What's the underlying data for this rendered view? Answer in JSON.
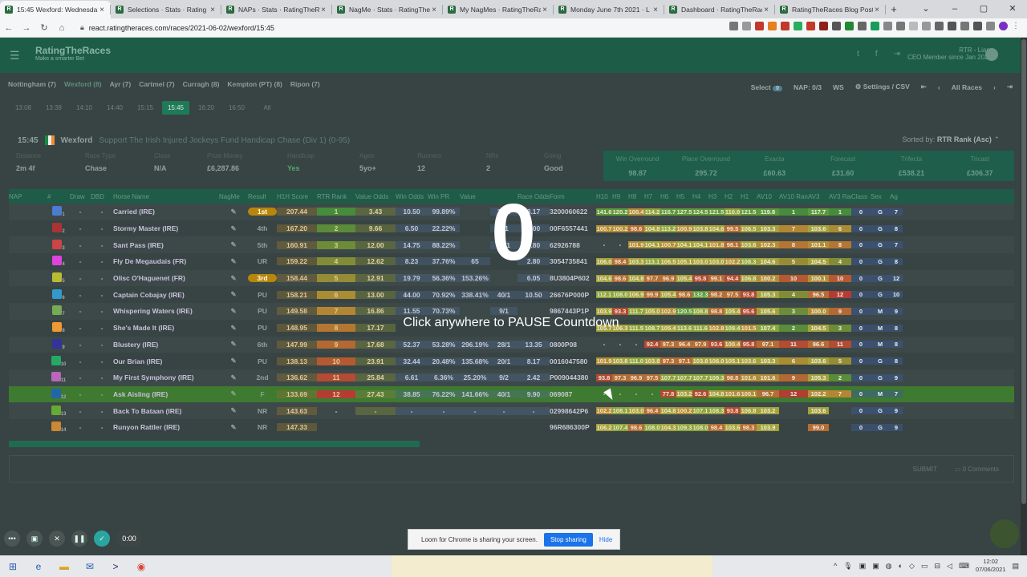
{
  "browser": {
    "tabs": [
      {
        "label": "15:45 Wexford: Wednesda",
        "active": true
      },
      {
        "label": "Selections · Stats · Rating",
        "active": false
      },
      {
        "label": "NAPs · Stats · RatingTheRa",
        "active": false
      },
      {
        "label": "NagMe · Stats · RatingTheRa",
        "active": false
      },
      {
        "label": "My NagMes · RatingTheRa",
        "active": false
      },
      {
        "label": "Monday June 7th 2021 · L",
        "active": false
      },
      {
        "label": "Dashboard · RatingTheRace",
        "active": false
      },
      {
        "label": "RatingTheRaces Blog Posts",
        "active": false
      }
    ],
    "url": "react.ratingtheraces.com/races/2021-06-02/wexford/15:45"
  },
  "site": {
    "logo": "RatingTheRaces",
    "tagline": "Make a smarter Bet",
    "user": "RTR - Liam",
    "user_sub": "CEO Member since Jan 2021"
  },
  "meetings": [
    "Nottingham (7)",
    "Wexford (8)",
    "Ayr (7)",
    "Cartmel (7)",
    "Curragh (8)",
    "Kempton (PT) (8)",
    "Ripon (7)"
  ],
  "active_meeting": "Wexford (8)",
  "controls": {
    "select": "Select",
    "select_count": "0",
    "nap": "NAP: 0/3",
    "ws": "WS",
    "settings": "Settings / CSV",
    "all_races": "All Races"
  },
  "times": [
    "13:08",
    "13:38",
    "14:10",
    "14:40",
    "15:15",
    "15:45",
    "16:20",
    "16:50",
    "All"
  ],
  "active_time": "15:45",
  "race": {
    "time": "15:45",
    "course": "Wexford",
    "name": "Support The Irish Injured Jockeys Fund Handicap Chase (Div 1) (0-95)",
    "sorted": "Sorted by:",
    "sorted_value": "RTR Rank (Asc)"
  },
  "info": [
    {
      "label": "Distance",
      "value": "2m 4f"
    },
    {
      "label": "Race Type",
      "value": "Chase"
    },
    {
      "label": "Class",
      "value": "N/A"
    },
    {
      "label": "Prize Money",
      "value": "£6,287.86"
    },
    {
      "label": "Handicap",
      "value": "Yes"
    },
    {
      "label": "Ages",
      "value": "5yo+"
    },
    {
      "label": "Runners",
      "value": "12"
    },
    {
      "label": "NRs",
      "value": "2"
    },
    {
      "label": "Going",
      "value": "Good"
    }
  ],
  "bets": [
    {
      "label": "Win Overround",
      "value": "98.87"
    },
    {
      "label": "Place Overround",
      "value": "295.72"
    },
    {
      "label": "Exacta",
      "value": "£60.63"
    },
    {
      "label": "Forecast",
      "value": "£31.60"
    },
    {
      "label": "Trifecta",
      "value": "£538.21"
    },
    {
      "label": "Tricast",
      "value": "£306.37"
    }
  ],
  "columns": [
    "NAP",
    "#",
    "Draw",
    "DBD",
    "Horse Name",
    "NagMe",
    "Result",
    "H1H Score",
    "RTR Rank",
    "Value Odds",
    "Win Odds",
    "Win PR",
    "Value",
    "",
    "Race Odds",
    "Form",
    "H10",
    "H9",
    "H8",
    "H7",
    "H6",
    "H5",
    "H4",
    "H3",
    "H2",
    "H1",
    "AV10",
    "AV10 Rank",
    "AV3",
    "AV3 Rank",
    "Class",
    "Sex",
    "Ag"
  ],
  "rows": [
    {
      "no": "1",
      "draw": "-",
      "dbd": "-",
      "name": "Carried (IRE)",
      "nag": "1",
      "result": "1st",
      "score": "207.44",
      "rank": "1",
      "vodds": "3.43",
      "wodds": "10.50",
      "wpr": "99.89%",
      "value": "",
      "frac": "13/1",
      "rodds": "8.17",
      "form": "3200060622",
      "h": [
        "141.6",
        "120.2",
        "100.4",
        "114.2",
        "116.7",
        "127.5",
        "124.5",
        "121.5",
        "110.0",
        "121.5"
      ],
      "av10": "119.8",
      "av10r": "1",
      "av3": "117.7",
      "av3r": "1",
      "cls": "0",
      "sex": "G",
      "ag": "7"
    },
    {
      "no": "2",
      "draw": "-",
      "dbd": "-",
      "name": "Stormy Master (IRE)",
      "nag": "",
      "result": "4th",
      "score": "167.20",
      "rank": "2",
      "vodds": "9.66",
      "wodds": "6.50",
      "wpr": "22.22%",
      "value": "",
      "frac": "4/1",
      "rodds": "5.00",
      "form": "00F6557441",
      "h": [
        "100.7",
        "100.2",
        "98.6",
        "104.8",
        "113.2",
        "100.9",
        "103.8",
        "104.6",
        "99.5",
        "106.5"
      ],
      "av10": "103.3",
      "av10r": "7",
      "av3": "103.6",
      "av3r": "6",
      "cls": "0",
      "sex": "G",
      "ag": "8"
    },
    {
      "no": "3",
      "draw": "-",
      "dbd": "-",
      "name": "Sant Pass (IRE)",
      "nag": "1",
      "result": "5th",
      "score": "160.91",
      "rank": "3",
      "vodds": "12.00",
      "wodds": "14.75",
      "wpr": "88.22%",
      "value": "",
      "frac": "11/1",
      "rodds": "4.80",
      "form": "62926788",
      "h": [
        "-",
        "-",
        "101.9",
        "104.1",
        "100.7",
        "104.1",
        "104.1",
        "101.8",
        "98.1",
        "103.6"
      ],
      "av10": "102.3",
      "av10r": "8",
      "av3": "101.1",
      "av3r": "8",
      "cls": "0",
      "sex": "G",
      "ag": "7"
    },
    {
      "no": "4",
      "draw": "-",
      "dbd": "-",
      "name": "Fly De Megaudais (FR)",
      "nag": "1",
      "result": "UR",
      "score": "159.22",
      "rank": "4",
      "vodds": "12.62",
      "wodds": "8.23",
      "wpr": "37.76%",
      "value": "65",
      "frac": "",
      "rodds": "2.80",
      "form": "3054735841",
      "h": [
        "106.0",
        "98.4",
        "103.3",
        "113.1",
        "106.5",
        "105.1",
        "103.0",
        "103.0",
        "102.2",
        "108.3"
      ],
      "av10": "104.6",
      "av10r": "5",
      "av3": "104.5",
      "av3r": "4",
      "cls": "0",
      "sex": "G",
      "ag": "8"
    },
    {
      "no": "5",
      "draw": "-",
      "dbd": "-",
      "name": "Olisc O'Haguenet (FR)",
      "nag": "",
      "result": "3rd",
      "score": "158.44",
      "rank": "5",
      "vodds": "12.91",
      "wodds": "19.79",
      "wpr": "56.36%",
      "value": "153.26%",
      "frac": "",
      "rodds": "6.05",
      "form": "8U3804P602",
      "h": [
        "104.6",
        "98.6",
        "104.8",
        "97.7",
        "96.9",
        "105.4",
        "95.8",
        "99.1",
        "94.4",
        "106.8"
      ],
      "av10": "100.2",
      "av10r": "10",
      "av3": "100.1",
      "av3r": "10",
      "cls": "0",
      "sex": "G",
      "ag": "12"
    },
    {
      "no": "6",
      "draw": "-",
      "dbd": "-",
      "name": "Captain Cobajay (IRE)",
      "nag": "",
      "result": "PU",
      "score": "158.21",
      "rank": "6",
      "vodds": "13.00",
      "wodds": "44.00",
      "wpr": "70.92%",
      "value": "338.41%",
      "frac": "40/1",
      "rodds": "10.50",
      "form": "26676P000P",
      "h": [
        "112.1",
        "108.0",
        "106.9",
        "99.9",
        "105.4",
        "98.6",
        "132.3",
        "98.2",
        "97.5",
        "93.8"
      ],
      "av10": "105.3",
      "av10r": "4",
      "av3": "96.5",
      "av3r": "12",
      "cls": "0",
      "sex": "G",
      "ag": "10"
    },
    {
      "no": "7",
      "draw": "-",
      "dbd": "-",
      "name": "Whispering Waters (IRE)",
      "nag": "",
      "result": "PU",
      "score": "149.58",
      "rank": "7",
      "vodds": "16.86",
      "wodds": "11.55",
      "wpr": "70.73%",
      "value": "",
      "frac": "9/1",
      "rodds": "",
      "form": "9867443P1P",
      "h": [
        "103.9",
        "93.3",
        "111.7",
        "105.0",
        "102.9",
        "120.5",
        "108.8",
        "98.8",
        "105.4",
        "95.6"
      ],
      "av10": "105.6",
      "av10r": "3",
      "av3": "100.0",
      "av3r": "9",
      "cls": "0",
      "sex": "M",
      "ag": "9"
    },
    {
      "no": "8",
      "draw": "-",
      "dbd": "-",
      "name": "She's Made It (IRE)",
      "nag": "",
      "result": "PU",
      "score": "148.95",
      "rank": "8",
      "vodds": "17.17",
      "wodds": "",
      "wpr": "",
      "value": "",
      "frac": "",
      "rodds": "",
      "form": "",
      "h": [
        "105.7",
        "106.3",
        "111.5",
        "108.7",
        "105.4",
        "113.6",
        "111.6",
        "102.8",
        "109.4",
        "101.5"
      ],
      "av10": "107.4",
      "av10r": "2",
      "av3": "104.5",
      "av3r": "3",
      "cls": "0",
      "sex": "M",
      "ag": "8"
    },
    {
      "no": "9",
      "draw": "-",
      "dbd": "-",
      "name": "Blustery (IRE)",
      "nag": "",
      "result": "6th",
      "score": "147.99",
      "rank": "9",
      "vodds": "17.68",
      "wodds": "52.37",
      "wpr": "53.28%",
      "value": "296.19%",
      "frac": "28/1",
      "rodds": "13.35",
      "form": "0800P08",
      "h": [
        "-",
        "-",
        "-",
        "92.4",
        "97.3",
        "96.4",
        "97.9",
        "93.6",
        "100.4",
        "95.8"
      ],
      "av10": "97.1",
      "av10r": "11",
      "av3": "96.6",
      "av3r": "11",
      "cls": "0",
      "sex": "M",
      "ag": "8"
    },
    {
      "no": "10",
      "draw": "-",
      "dbd": "-",
      "name": "Our Brian (IRE)",
      "nag": "",
      "result": "PU",
      "score": "138.13",
      "rank": "10",
      "vodds": "23.91",
      "wodds": "32.44",
      "wpr": "20.48%",
      "value": "135.68%",
      "frac": "20/1",
      "rodds": "8.17",
      "form": "0016047580",
      "h": [
        "101.9",
        "103.8",
        "111.0",
        "103.8",
        "97.3",
        "97.1",
        "103.8",
        "106.0",
        "105.1",
        "103.6"
      ],
      "av10": "103.3",
      "av10r": "6",
      "av3": "103.6",
      "av3r": "5",
      "cls": "0",
      "sex": "G",
      "ag": "8"
    },
    {
      "no": "11",
      "draw": "-",
      "dbd": "-",
      "name": "My First Symphony (IRE)",
      "nag": "1",
      "result": "2nd",
      "score": "136.62",
      "rank": "11",
      "vodds": "25.84",
      "wodds": "6.61",
      "wpr": "6.36%",
      "value": "25.20%",
      "frac": "9/2",
      "rodds": "2.42",
      "form": "P009044380",
      "h": [
        "93.8",
        "97.3",
        "96.9",
        "97.5",
        "107.7",
        "107.7",
        "107.7",
        "109.3",
        "98.8",
        "101.6"
      ],
      "av10": "101.6",
      "av10r": "9",
      "av3": "105.3",
      "av3r": "2",
      "cls": "0",
      "sex": "G",
      "ag": "9"
    },
    {
      "no": "12",
      "draw": "-",
      "dbd": "-",
      "name": "Ask Aisling (IRE)",
      "nag": "",
      "result": "F",
      "score": "133.69",
      "rank": "12",
      "vodds": "27.43",
      "wodds": "38.85",
      "wpr": "76.22%",
      "value": "141.66%",
      "frac": "40/1",
      "rodds": "9.90",
      "form": "069087",
      "h": [
        "-",
        "-",
        "-",
        "-",
        "77.8",
        "103.2",
        "92.6",
        "104.8",
        "101.6",
        "100.1"
      ],
      "av10": "96.7",
      "av10r": "12",
      "av3": "102.2",
      "av3r": "7",
      "cls": "0",
      "sex": "M",
      "ag": "7",
      "hl": true
    },
    {
      "no": "13",
      "draw": "-",
      "dbd": "-",
      "name": "Back To Bataan (IRE)",
      "nag": "",
      "result": "NR",
      "score": "143.63",
      "rank": "-",
      "vodds": "-",
      "wodds": "-",
      "wpr": "-",
      "value": "-",
      "frac": "-",
      "rodds": "-",
      "form": "02998642P6",
      "h": [
        "102.2",
        "108.1",
        "103.0",
        "96.4",
        "104.8",
        "100.2",
        "107.1",
        "108.3",
        "93.8",
        "106.8"
      ],
      "av10": "103.2",
      "av10r": "",
      "av3": "103.6",
      "av3r": "",
      "cls": "0",
      "sex": "G",
      "ag": "9"
    },
    {
      "no": "14",
      "draw": "-",
      "dbd": "-",
      "name": "Runyon Rattler (IRE)",
      "nag": "",
      "result": "NR",
      "score": "147.33",
      "rank": "",
      "vodds": "",
      "wodds": "",
      "wpr": "",
      "value": "",
      "frac": "",
      "rodds": "",
      "form": "96R686300P",
      "h": [
        "106.2",
        "107.4",
        "98.6",
        "108.0",
        "104.3",
        "109.3",
        "108.0",
        "98.4",
        "103.6",
        "98.3"
      ],
      "av10": "103.9",
      "av10r": "",
      "av3": "99.0",
      "av3r": "",
      "cls": "0",
      "sex": "G",
      "ag": "9"
    }
  ],
  "footer": {
    "submit": "SUBMIT",
    "comments": "0 Comments"
  },
  "overlay": {
    "number": "0",
    "text": "Click anywhere to PAUSE Countdown"
  },
  "recorder": {
    "timer": "0:00"
  },
  "share": {
    "text": "Loom for Chrome is sharing your screen.",
    "stop": "Stop sharing",
    "hide": "Hide"
  },
  "taskbar": {
    "time": "12:02",
    "date": "07/06/2021"
  }
}
